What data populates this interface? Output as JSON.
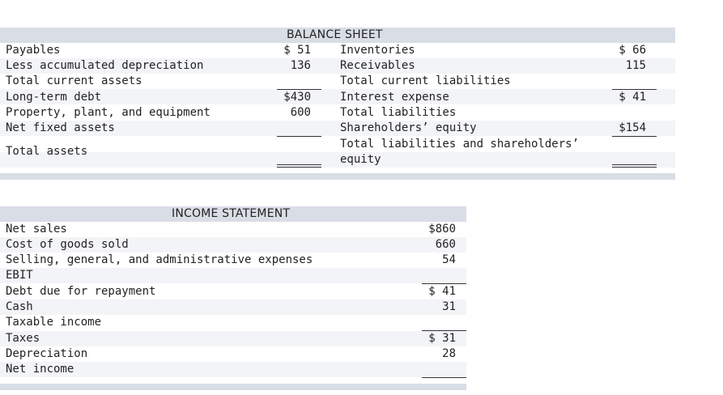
{
  "balance_sheet": {
    "title": "BALANCE SHEET",
    "left_labels": [
      "Payables",
      "Less accumulated depreciation",
      "Total current assets",
      "Long-term debt",
      "Property, plant, and equipment",
      "Net fixed assets",
      "Total assets"
    ],
    "left_values": [
      "$ 51",
      "136",
      "$430",
      "600"
    ],
    "right_labels": [
      "Inventories",
      "Receivables",
      "Total current liabilities",
      "Interest expense",
      "Total liabilities",
      "Shareholders’ equity",
      "Total liabilities and shareholders’",
      "equity"
    ],
    "right_values": [
      "$ 66",
      "115",
      "$ 41",
      "$154"
    ]
  },
  "income_statement": {
    "title": "INCOME STATEMENT",
    "labels": [
      "Net sales",
      "Cost of goods sold",
      "Selling, general, and administrative expenses",
      "EBIT",
      "Debt due for repayment",
      "Cash",
      "Taxable income",
      "Taxes",
      "Depreciation",
      "Net income"
    ],
    "values": [
      "$860",
      "660",
      "54",
      "$ 41",
      "31",
      "$ 31",
      "28"
    ]
  }
}
